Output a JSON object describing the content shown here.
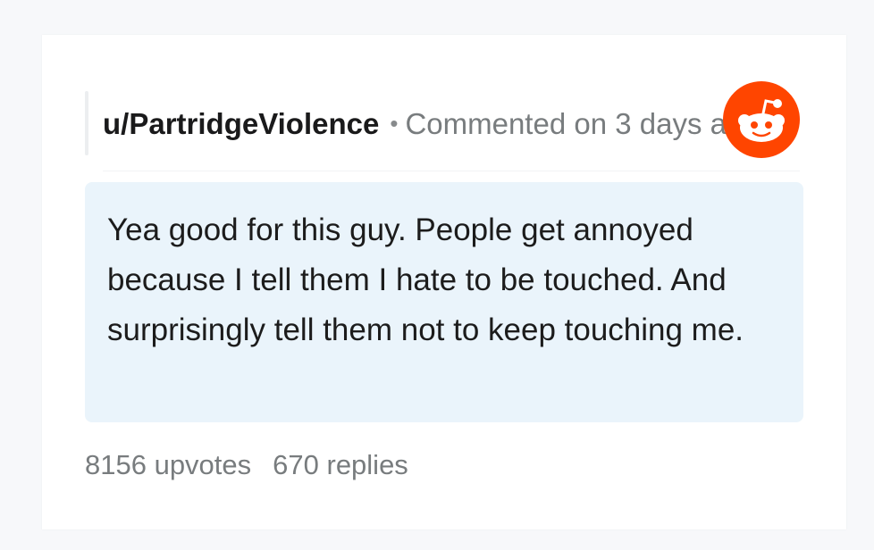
{
  "comment": {
    "username": "u/PartridgeViolence",
    "separator": "•",
    "meta": "Commented on 3 days ago",
    "text": "Yea good for this guy. People get annoyed because I tell them I hate to be touched. And surprisingly tell them not to keep touching me."
  },
  "footer": {
    "upvotes": "8156 upvotes",
    "replies": "670 replies"
  },
  "logo": {
    "icon": "reddit-icon",
    "color": "#ff4500"
  },
  "colors": {
    "comment_bg": "#eaf4fb",
    "muted_text": "#787c7e"
  }
}
